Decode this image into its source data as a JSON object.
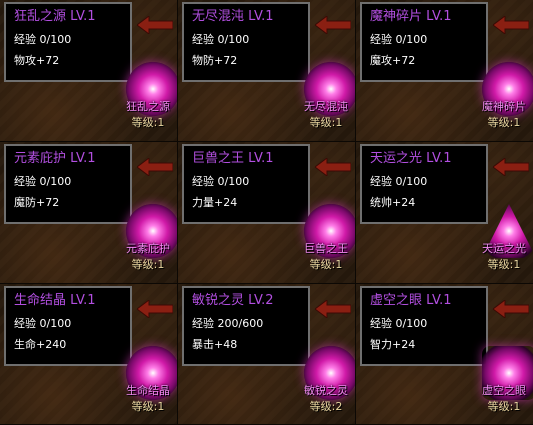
{
  "cards": [
    {
      "title": "狂乱之源 LV.1",
      "exp": "经验 0/100",
      "stat": "物攻+72",
      "orb_name": "狂乱之源",
      "orb_level": "等级:1",
      "orb_shape": "orb"
    },
    {
      "title": "无尽混沌 LV.1",
      "exp": "经验 0/100",
      "stat": "物防+72",
      "orb_name": "无尽混沌",
      "orb_level": "等级:1",
      "orb_shape": "orb"
    },
    {
      "title": "魔神碎片 LV.1",
      "exp": "经验 0/100",
      "stat": "魔攻+72",
      "orb_name": "魔神碎片",
      "orb_level": "等级:1",
      "orb_shape": "orb"
    },
    {
      "title": "元素庇护 LV.1",
      "exp": "经验 0/100",
      "stat": "魔防+72",
      "orb_name": "元素庇护",
      "orb_level": "等级:1",
      "orb_shape": "orb"
    },
    {
      "title": "巨兽之王 LV.1",
      "exp": "经验 0/100",
      "stat": "力量+24",
      "orb_name": "巨兽之王",
      "orb_level": "等级:1",
      "orb_shape": "orb"
    },
    {
      "title": "天运之光 LV.1",
      "exp": "经验 0/100",
      "stat": "统帅+24",
      "orb_name": "天运之光",
      "orb_level": "等级:1",
      "orb_shape": "crystal"
    },
    {
      "title": "生命结晶 LV.1",
      "exp": "经验 0/100",
      "stat": "生命+240",
      "orb_name": "生命结晶",
      "orb_level": "等级:1",
      "orb_shape": "orb"
    },
    {
      "title": "敏锐之灵 LV.2",
      "exp": "经验 200/600",
      "stat": "暴击+48",
      "orb_name": "敏锐之灵",
      "orb_level": "等级:2",
      "orb_shape": "orb"
    },
    {
      "title": "虚空之眼 LV.1",
      "exp": "经验 0/100",
      "stat": "智力+24",
      "orb_name": "虚空之眼",
      "orb_level": "等级:1",
      "orb_shape": "sq"
    }
  ],
  "colors": {
    "title": "#b24fe0",
    "orb_name": "#f08af0",
    "level": "#e8d6a0",
    "arrow": "#8a1f12"
  },
  "icons": {
    "arrow": "red-left-arrow-icon",
    "orb": "gem-orb-icon"
  }
}
